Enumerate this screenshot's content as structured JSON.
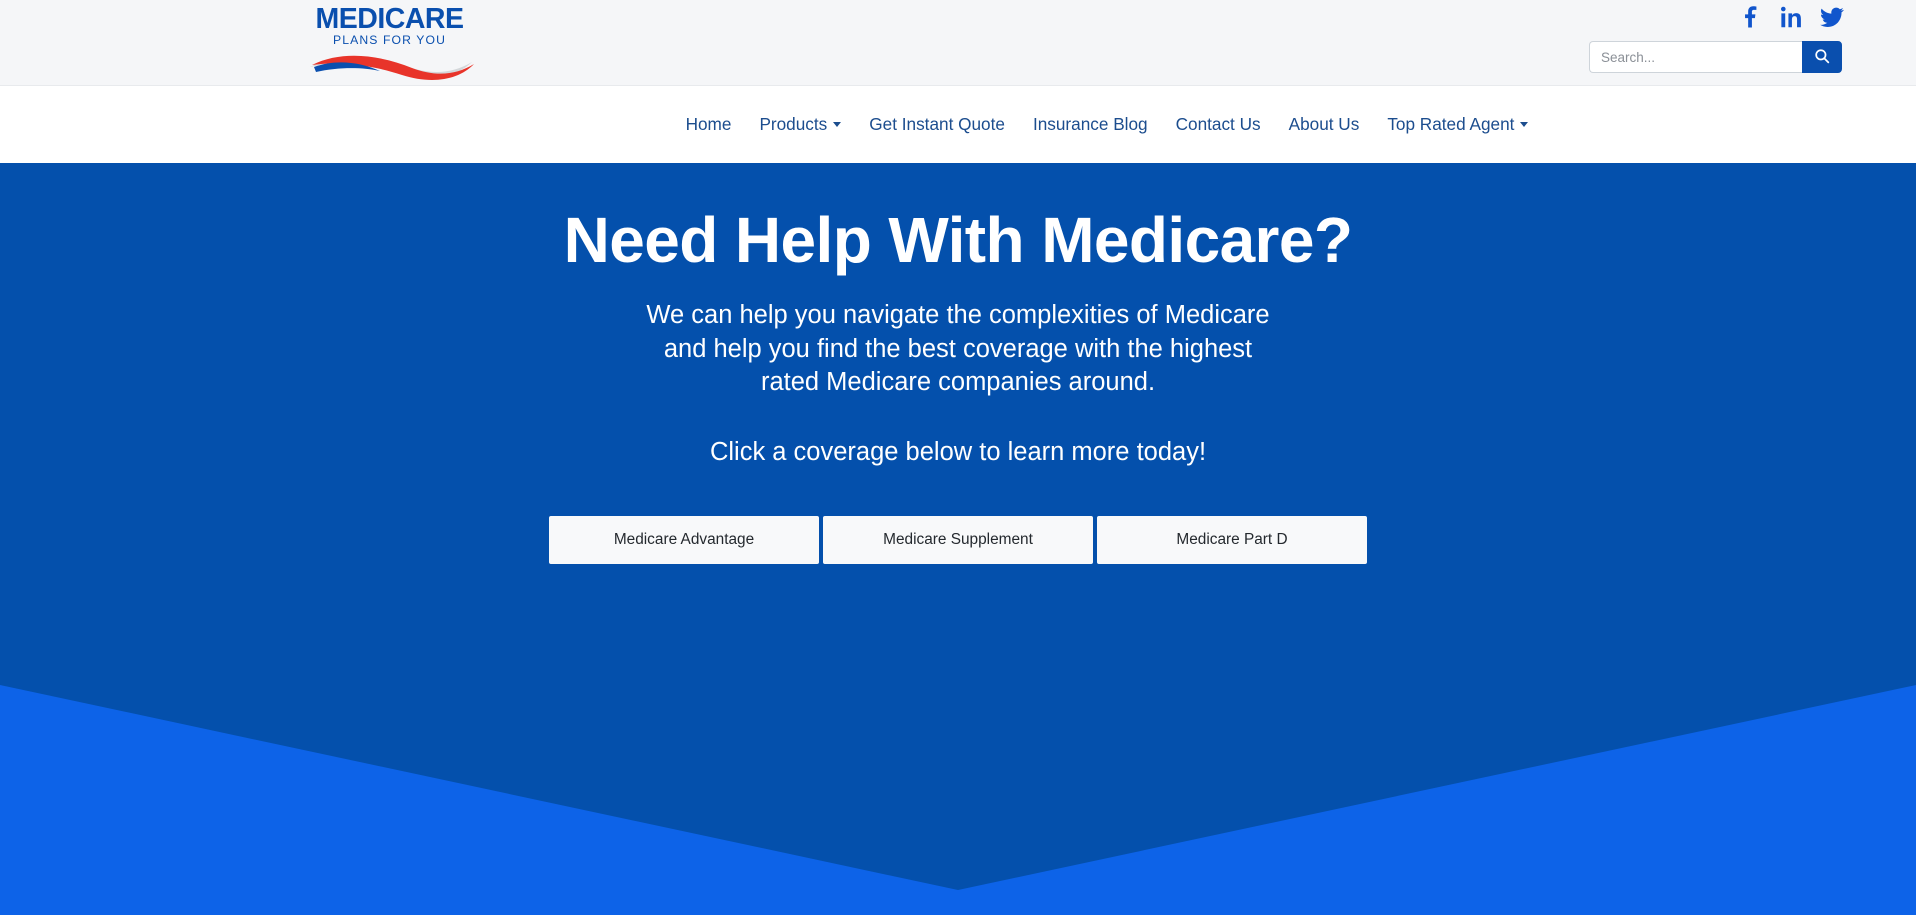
{
  "brand": {
    "name": "MEDICARE",
    "tagline": "PLANS FOR YOU",
    "logo_blue": "#0a4fae",
    "logo_red": "#e8342a",
    "logo_gray": "#d4d7da"
  },
  "topbar": {
    "background": "#f5f6f8",
    "social": [
      {
        "name": "facebook-icon",
        "label": "Facebook"
      },
      {
        "name": "linkedin-icon",
        "label": "LinkedIn"
      },
      {
        "name": "twitter-icon",
        "label": "Twitter"
      }
    ],
    "search": {
      "placeholder": "Search...",
      "value": "",
      "button_icon": "search-icon",
      "button_color": "#0a4fae"
    }
  },
  "nav": {
    "background": "#ffffff",
    "text_color": "#1c4d8e",
    "items": [
      {
        "label": "Home",
        "has_dropdown": false
      },
      {
        "label": "Products",
        "has_dropdown": true
      },
      {
        "label": "Get Instant Quote",
        "has_dropdown": false
      },
      {
        "label": "Insurance Blog",
        "has_dropdown": false
      },
      {
        "label": "Contact Us",
        "has_dropdown": false
      },
      {
        "label": "About Us",
        "has_dropdown": false
      },
      {
        "label": "Top Rated Agent",
        "has_dropdown": true
      }
    ]
  },
  "hero": {
    "background": "#0450ac",
    "wedge_color": "#0d63e8",
    "title": "Need Help With Medicare?",
    "subtitle_line1": "We can help you navigate the complexities of Medicare",
    "subtitle_line2": "and help you find the best coverage with the highest",
    "subtitle_line3": "rated Medicare companies around.",
    "cta_text": "Click a coverage below to learn more today!",
    "buttons": [
      {
        "label": "Medicare Advantage"
      },
      {
        "label": "Medicare Supplement"
      },
      {
        "label": "Medicare Part D"
      }
    ]
  }
}
